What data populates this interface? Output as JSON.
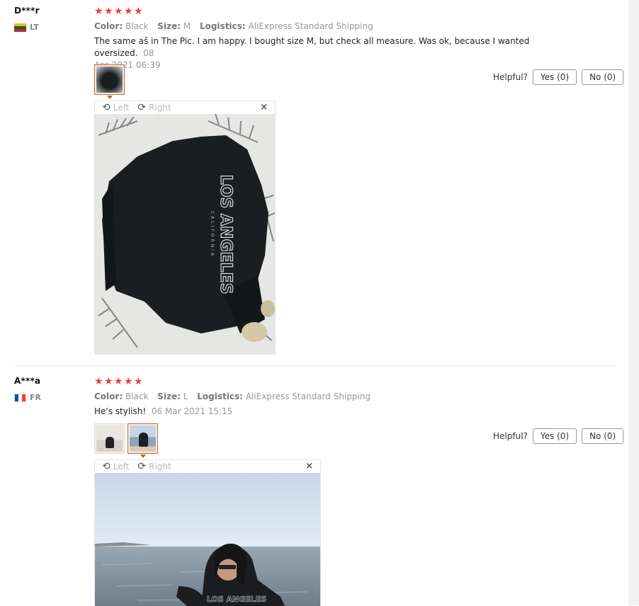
{
  "reviews": [
    {
      "user": "D***r",
      "country": "LT",
      "rating": 5,
      "color_label": "Color:",
      "color": "Black",
      "size_label": "Size:",
      "size": "M",
      "logistics_label": "Logistics:",
      "logistics": "AliExpress Standard Shipping",
      "text": "The same aš in The Pic. I am happy. I bought size M, but check all measure. Was ok, because I wanted oversized.",
      "date_a": "08",
      "date_b": "Apr 2021 06:39",
      "helpful_label": "Helpful?",
      "yes_label": "Yes (0)",
      "no_label": "No (0)",
      "rotate_left": "Left",
      "rotate_right": "Right",
      "close": "×",
      "photo_text": "LOS ANGELES",
      "photo_subtext": "CALIFORNIA"
    },
    {
      "user": "A***a",
      "country": "FR",
      "rating": 5,
      "color_label": "Color:",
      "color": "Black",
      "size_label": "Size:",
      "size": "L",
      "logistics_label": "Logistics:",
      "logistics": "AliExpress Standard Shipping",
      "text": "He's stylish!",
      "date": "06 Mar 2021 15:15",
      "helpful_label": "Helpful?",
      "yes_label": "Yes (0)",
      "no_label": "No (0)",
      "rotate_left": "Left",
      "rotate_right": "Right",
      "close": "×",
      "photo_text": "LOS ANGELES"
    }
  ],
  "icons": {
    "star": "star-icon",
    "rotate_left": "rotate-left-icon",
    "rotate_right": "rotate-right-icon",
    "close": "close-icon"
  },
  "colors": {
    "star": "#e8413d",
    "accent": "#d0632a"
  }
}
